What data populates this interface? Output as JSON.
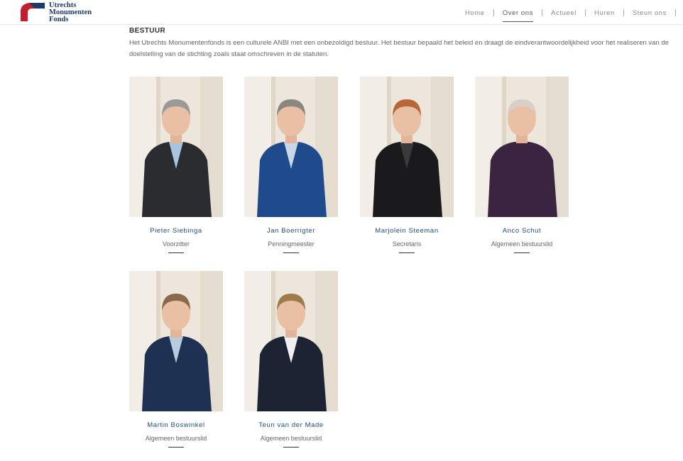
{
  "logo": {
    "lines": [
      "Utrechts",
      "Monumenten",
      "Fonds"
    ]
  },
  "nav": {
    "items": [
      {
        "label": "Home"
      },
      {
        "label": "Over ons",
        "active": true
      },
      {
        "label": "Actueel"
      },
      {
        "label": "Huren"
      },
      {
        "label": "Steun ons"
      }
    ]
  },
  "section": {
    "title": "BESTUUR",
    "intro": "Het Utrechts Monumentenfonds is een culturele ANBI met een onbezoldigd bestuur. Het bestuur bepaald het beleid en draagt de eindverantwoordelijkheid voor het realiseren van de doelstelling van de stichting zoals staat omschreven in de statuten."
  },
  "members": [
    {
      "name": "Pieter Siebinga",
      "role": "Voorzitter",
      "jacket": "#2a2c30",
      "shirt": "#a8c4e0",
      "hair": "#9a9a98"
    },
    {
      "name": "Jan Boerrigter",
      "role": "Penningmeester",
      "jacket": "#1f4a8c",
      "shirt": "#c8d8e8",
      "hair": "#8a8680"
    },
    {
      "name": "Marjolein Steeman",
      "role": "Secretaris",
      "jacket": "#1a1a1c",
      "shirt": "#3a3a3a",
      "hair": "#b8673a"
    },
    {
      "name": "Anco Schut",
      "role": "Algemeen bestuurslid",
      "jacket": "#3a2440",
      "shirt": "#3a2440",
      "hair": "#d8d0c8"
    },
    {
      "name": "Martin Boswinkel",
      "role": "Algemeen bestuurslid",
      "jacket": "#1e3152",
      "shirt": "#b8cce0",
      "hair": "#8a6a4a"
    },
    {
      "name": "Teun van der Made",
      "role": "Algemeen bestuurslid",
      "jacket": "#1c2434",
      "shirt": "#f0f0f0",
      "hair": "#a07a4a"
    }
  ]
}
